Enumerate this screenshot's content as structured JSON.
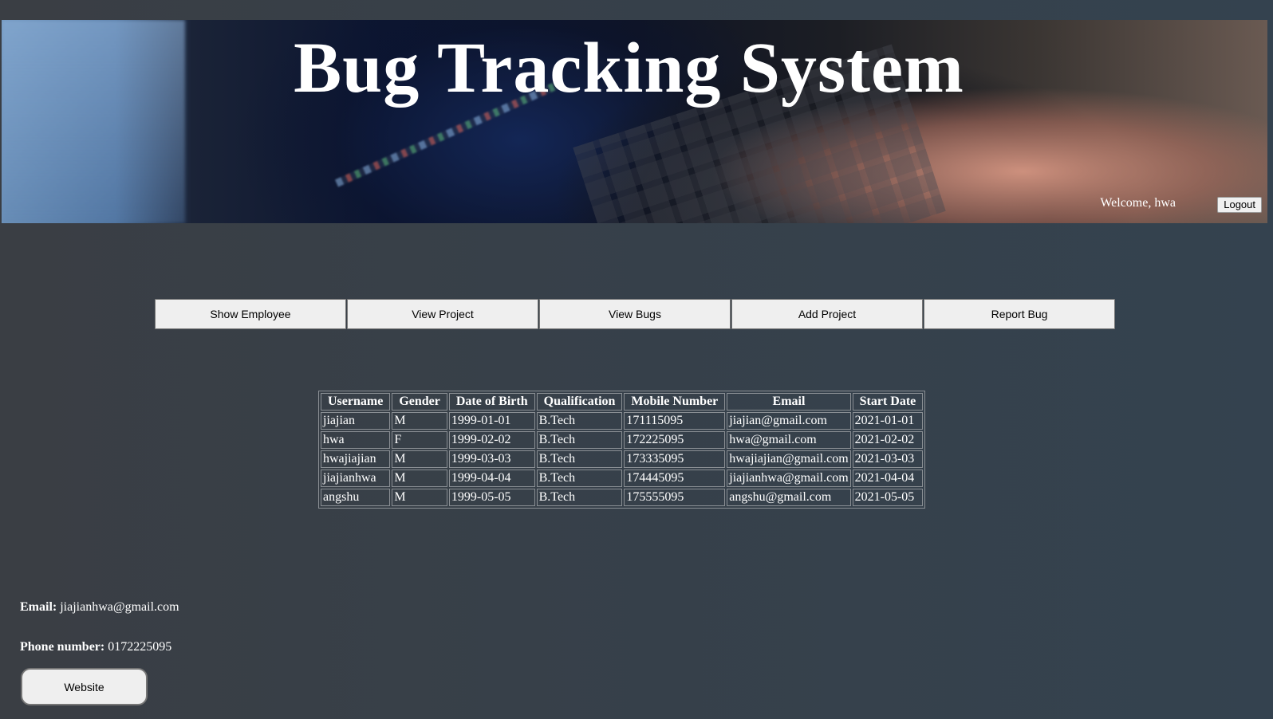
{
  "header": {
    "title": "Bug Tracking System",
    "welcome_text": "Welcome, hwa",
    "logout_label": "Logout"
  },
  "nav": {
    "buttons": [
      {
        "label": "Show Employee"
      },
      {
        "label": "View Project"
      },
      {
        "label": "View Bugs"
      },
      {
        "label": "Add Project"
      },
      {
        "label": "Report Bug"
      }
    ]
  },
  "employees": {
    "columns": [
      "Username",
      "Gender",
      "Date of Birth",
      "Qualification",
      "Mobile Number",
      "Email",
      "Start Date"
    ],
    "rows": [
      [
        "jiajian",
        "M",
        "1999-01-01",
        "B.Tech",
        "171115095",
        "jiajian@gmail.com",
        "2021-01-01"
      ],
      [
        "hwa",
        "F",
        "1999-02-02",
        "B.Tech",
        "172225095",
        "hwa@gmail.com",
        "2021-02-02"
      ],
      [
        "hwajiajian",
        "M",
        "1999-03-03",
        "B.Tech",
        "173335095",
        "hwajiajian@gmail.com",
        "2021-03-03"
      ],
      [
        "jiajianhwa",
        "M",
        "1999-04-04",
        "B.Tech",
        "174445095",
        "jiajianhwa@gmail.com",
        "2021-04-04"
      ],
      [
        "angshu",
        "M",
        "1999-05-05",
        "B.Tech",
        "175555095",
        "angshu@gmail.com",
        "2021-05-05"
      ]
    ]
  },
  "footer": {
    "email_label": "Email:",
    "email_value": "jiajianhwa@gmail.com",
    "phone_label": "Phone number:",
    "phone_value": "0172225095",
    "website_label": "Website"
  }
}
